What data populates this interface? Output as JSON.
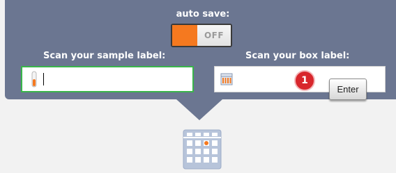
{
  "autosave": {
    "label": "auto save:",
    "state": "OFF",
    "on_color": "#f5791f"
  },
  "sample": {
    "label": "Scan your sample label:",
    "value": "",
    "icon": "test-tube-icon"
  },
  "box": {
    "label": "Scan your box label:",
    "value": "",
    "icon": "box-rack-icon"
  },
  "badge": {
    "count": "1",
    "color": "#d8262c"
  },
  "enter_key": {
    "label": "Enter"
  },
  "colors": {
    "panel": "#6b7691",
    "active_border": "#39b54a"
  },
  "grid_icon": {
    "name": "box-grid-icon",
    "highlight_color": "#f5791f"
  }
}
